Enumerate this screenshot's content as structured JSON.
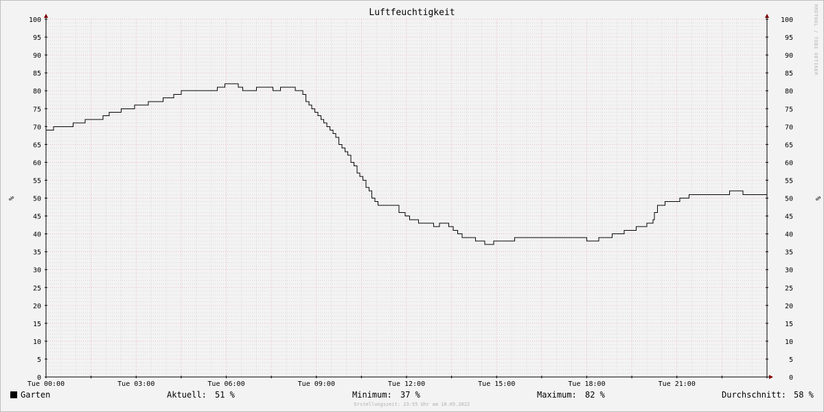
{
  "title": "Luftfeuchtigkeit",
  "watermark": "RRDTOOL / TOBI OETIKER",
  "footer": "Erstellungszeit: 23:55 Uhr am 10.05.2022",
  "legend": {
    "series_name": "Garten",
    "aktuell_label": "Aktuell:",
    "aktuell_value": "51 %",
    "minimum_label": "Minimum:",
    "minimum_value": "37 %",
    "maximum_label": "Maximum:",
    "maximum_value": "82 %",
    "avg_label": "Durchschnitt:",
    "avg_value": "58 %"
  },
  "colors": {
    "background": "#f3f3f3",
    "line": "#000000",
    "major_grid": "#e6a0b4",
    "minor_grid": "#c8c8c8",
    "arrow": "#800000"
  },
  "chart_data": {
    "type": "line",
    "title": "Luftfeuchtigkeit",
    "ylabel": "%",
    "xlabel": "",
    "ylim": [
      0,
      100
    ],
    "xlim_hours": [
      0,
      24
    ],
    "y_ticks": [
      0,
      5,
      10,
      15,
      20,
      25,
      30,
      35,
      40,
      45,
      50,
      55,
      60,
      65,
      70,
      75,
      80,
      85,
      90,
      95,
      100
    ],
    "x_tick_labels": [
      "Tue 00:00",
      "Tue 03:00",
      "Tue 06:00",
      "Tue 09:00",
      "Tue 12:00",
      "Tue 15:00",
      "Tue 18:00",
      "Tue 21:00"
    ],
    "x_tick_hours": [
      0,
      3,
      6,
      9,
      12,
      15,
      18,
      21
    ],
    "grid": true,
    "step": true,
    "series": [
      {
        "name": "Garten",
        "hours": [
          0,
          0.25,
          0.55,
          0.9,
          1.3,
          1.65,
          1.9,
          2.1,
          2.5,
          2.95,
          3.4,
          3.9,
          4.25,
          4.5,
          5.7,
          5.95,
          6.4,
          6.5,
          6.55,
          7.0,
          7.25,
          7.55,
          7.8,
          8.3,
          8.55,
          8.65,
          8.75,
          8.85,
          8.95,
          9.05,
          9.15,
          9.25,
          9.35,
          9.45,
          9.55,
          9.65,
          9.75,
          9.85,
          9.95,
          10.05,
          10.15,
          10.25,
          10.35,
          10.45,
          10.55,
          10.65,
          10.75,
          10.85,
          10.95,
          11.05,
          11.15,
          11.3,
          11.75,
          11.95,
          12.1,
          12.4,
          12.9,
          13.1,
          13.4,
          13.55,
          13.7,
          13.85,
          14.3,
          14.6,
          14.9,
          15.6,
          17.6,
          18.0,
          18.4,
          18.85,
          19.25,
          19.65,
          20.0,
          20.2,
          20.25,
          20.35,
          20.6,
          21.1,
          21.4,
          22.75,
          23.2,
          23.4
        ],
        "values": [
          69,
          70,
          70,
          71,
          72,
          72,
          73,
          74,
          75,
          76,
          77,
          78,
          79,
          80,
          81,
          82,
          81,
          81,
          80,
          81,
          81,
          80,
          81,
          80,
          79,
          77,
          76,
          75,
          74,
          73,
          72,
          71,
          70,
          69,
          68,
          67,
          65,
          64,
          63,
          62,
          60,
          59,
          57,
          56,
          55,
          53,
          52,
          50,
          49,
          48,
          48,
          48,
          46,
          45,
          44,
          43,
          42,
          43,
          42,
          41,
          40,
          39,
          38,
          37,
          38,
          39,
          39,
          38,
          39,
          40,
          41,
          42,
          43,
          44,
          46,
          48,
          49,
          50,
          51,
          52,
          51,
          51
        ]
      }
    ]
  }
}
